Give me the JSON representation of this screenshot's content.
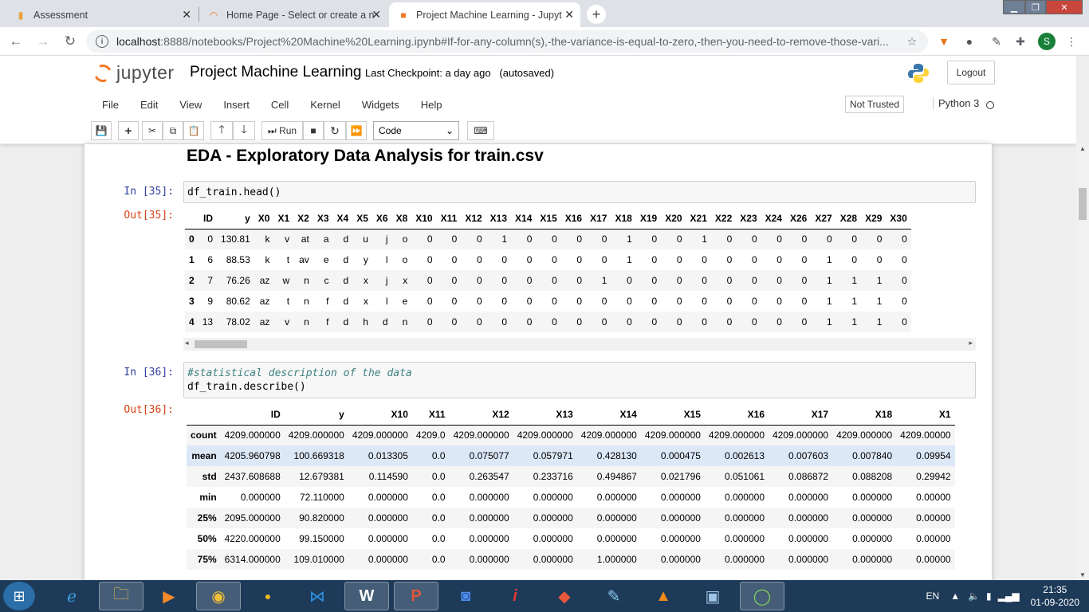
{
  "browser": {
    "tabs": [
      {
        "title": "Assessment",
        "icon": "bar-chart-icon"
      },
      {
        "title": "Home Page - Select or create a n",
        "icon": "loading-icon"
      },
      {
        "title": "Project Machine Learning - Jupyt",
        "icon": "jupyter-icon"
      }
    ],
    "url_host": "localhost",
    "url_rest": ":8888/notebooks/Project%20Machine%20Learning.ipynb#If-for-any-column(s),-the-variance-is-equal-to-zero,-then-you-need-to-remove-those-vari...",
    "profile_initial": "S"
  },
  "jupyter": {
    "logo_text": "jupyter",
    "notebook_title": "Project Machine Learning",
    "checkpoint": "Last Checkpoint: a day ago",
    "autosave": "(autosaved)",
    "logout": "Logout",
    "menu": [
      "File",
      "Edit",
      "View",
      "Insert",
      "Cell",
      "Kernel",
      "Widgets",
      "Help"
    ],
    "trust": "Not Trusted",
    "kernel": "Python 3",
    "run_label": "Run",
    "cell_type": "Code"
  },
  "notebook": {
    "heading": "EDA - Exploratory Data Analysis for train.csv",
    "cell35": {
      "in_prompt": "In [35]:",
      "out_prompt": "Out[35]:",
      "code": "df_train.head()"
    },
    "cell36": {
      "in_prompt": "In [36]:",
      "out_prompt": "Out[36]:",
      "comment": "#statistical description of the data",
      "code": "df_train.describe()"
    }
  },
  "head_table": {
    "columns": [
      "",
      "ID",
      "y",
      "X0",
      "X1",
      "X2",
      "X3",
      "X4",
      "X5",
      "X6",
      "X8",
      "X10",
      "X11",
      "X12",
      "X13",
      "X14",
      "X15",
      "X16",
      "X17",
      "X18",
      "X19",
      "X20",
      "X21",
      "X22",
      "X23",
      "X24",
      "X26",
      "X27",
      "X28",
      "X29",
      "X30"
    ],
    "rows": [
      [
        "0",
        "0",
        "130.81",
        "k",
        "v",
        "at",
        "a",
        "d",
        "u",
        "j",
        "o",
        "0",
        "0",
        "0",
        "1",
        "0",
        "0",
        "0",
        "0",
        "1",
        "0",
        "0",
        "1",
        "0",
        "0",
        "0",
        "0",
        "0",
        "0",
        "0",
        "0"
      ],
      [
        "1",
        "6",
        "88.53",
        "k",
        "t",
        "av",
        "e",
        "d",
        "y",
        "l",
        "o",
        "0",
        "0",
        "0",
        "0",
        "0",
        "0",
        "0",
        "0",
        "1",
        "0",
        "0",
        "0",
        "0",
        "0",
        "0",
        "0",
        "1",
        "0",
        "0",
        "0"
      ],
      [
        "2",
        "7",
        "76.26",
        "az",
        "w",
        "n",
        "c",
        "d",
        "x",
        "j",
        "x",
        "0",
        "0",
        "0",
        "0",
        "0",
        "0",
        "0",
        "1",
        "0",
        "0",
        "0",
        "0",
        "0",
        "0",
        "0",
        "0",
        "1",
        "1",
        "1",
        "0"
      ],
      [
        "3",
        "9",
        "80.62",
        "az",
        "t",
        "n",
        "f",
        "d",
        "x",
        "l",
        "e",
        "0",
        "0",
        "0",
        "0",
        "0",
        "0",
        "0",
        "0",
        "0",
        "0",
        "0",
        "0",
        "0",
        "0",
        "0",
        "0",
        "1",
        "1",
        "1",
        "0"
      ],
      [
        "4",
        "13",
        "78.02",
        "az",
        "v",
        "n",
        "f",
        "d",
        "h",
        "d",
        "n",
        "0",
        "0",
        "0",
        "0",
        "0",
        "0",
        "0",
        "0",
        "0",
        "0",
        "0",
        "0",
        "0",
        "0",
        "0",
        "0",
        "1",
        "1",
        "1",
        "0"
      ]
    ]
  },
  "describe_table": {
    "columns": [
      "",
      "ID",
      "y",
      "X10",
      "X11",
      "X12",
      "X13",
      "X14",
      "X15",
      "X16",
      "X17",
      "X18",
      "X1"
    ],
    "rows": [
      [
        "count",
        "4209.000000",
        "4209.000000",
        "4209.000000",
        "4209.0",
        "4209.000000",
        "4209.000000",
        "4209.000000",
        "4209.000000",
        "4209.000000",
        "4209.000000",
        "4209.000000",
        "4209.00000"
      ],
      [
        "mean",
        "4205.960798",
        "100.669318",
        "0.013305",
        "0.0",
        "0.075077",
        "0.057971",
        "0.428130",
        "0.000475",
        "0.002613",
        "0.007603",
        "0.007840",
        "0.09954"
      ],
      [
        "std",
        "2437.608688",
        "12.679381",
        "0.114590",
        "0.0",
        "0.263547",
        "0.233716",
        "0.494867",
        "0.021796",
        "0.051061",
        "0.086872",
        "0.088208",
        "0.29942"
      ],
      [
        "min",
        "0.000000",
        "72.110000",
        "0.000000",
        "0.0",
        "0.000000",
        "0.000000",
        "0.000000",
        "0.000000",
        "0.000000",
        "0.000000",
        "0.000000",
        "0.00000"
      ],
      [
        "25%",
        "2095.000000",
        "90.820000",
        "0.000000",
        "0.0",
        "0.000000",
        "0.000000",
        "0.000000",
        "0.000000",
        "0.000000",
        "0.000000",
        "0.000000",
        "0.00000"
      ],
      [
        "50%",
        "4220.000000",
        "99.150000",
        "0.000000",
        "0.0",
        "0.000000",
        "0.000000",
        "0.000000",
        "0.000000",
        "0.000000",
        "0.000000",
        "0.000000",
        "0.00000"
      ],
      [
        "75%",
        "6314.000000",
        "109.010000",
        "0.000000",
        "0.0",
        "0.000000",
        "0.000000",
        "1.000000",
        "0.000000",
        "0.000000",
        "0.000000",
        "0.000000",
        "0.00000"
      ]
    ]
  },
  "taskbar": {
    "language": "EN",
    "time": "21:35",
    "date": "01-09-2020"
  }
}
